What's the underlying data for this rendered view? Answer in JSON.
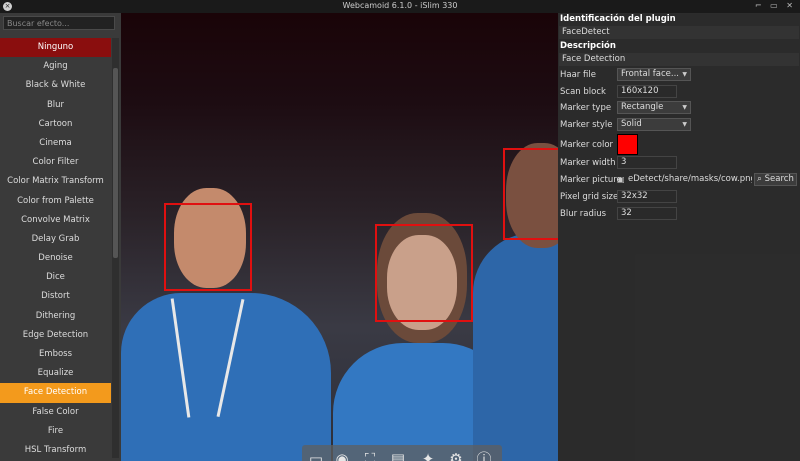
{
  "window": {
    "title": "Webcamoid 6.1.0 - iSlim 330"
  },
  "filters": {
    "search_placeholder": "Buscar efecto...",
    "items": [
      "Ninguno",
      "Aging",
      "Black & White",
      "Blur",
      "Cartoon",
      "Cinema",
      "Color Filter",
      "Color Matrix Transform",
      "Color from Palette",
      "Convolve Matrix",
      "Delay Grab",
      "Denoise",
      "Dice",
      "Distort",
      "Dithering",
      "Edge Detection",
      "Emboss",
      "Equalize",
      "Face Detection",
      "False Color",
      "Fire",
      "HSL Transform"
    ],
    "selected": "Face Detection"
  },
  "plugin": {
    "id_header": "Identificación del plugin",
    "id_value": "FaceDetect",
    "desc_header": "Descripción",
    "desc_value": "Face Detection"
  },
  "props": {
    "haar_file": {
      "label": "Haar file",
      "value": "Frontal face..."
    },
    "scan_block": {
      "label": "Scan block",
      "value": "160x120"
    },
    "marker_type": {
      "label": "Marker type",
      "value": "Rectangle"
    },
    "marker_style": {
      "label": "Marker style",
      "value": "Solid"
    },
    "marker_color": {
      "label": "Marker color",
      "value": "#ff0000"
    },
    "marker_width": {
      "label": "Marker width",
      "value": "3"
    },
    "marker_picture": {
      "label": "Marker picture",
      "value": "eDetect/share/masks/cow.png",
      "button": "Search"
    },
    "pixel_grid_size": {
      "label": "Pixel grid size",
      "value": "32x32"
    },
    "blur_radius": {
      "label": "Blur radius",
      "value": "32"
    }
  },
  "colors": {
    "selected_item": "#f39a1c",
    "first_item": "#8a0e0e",
    "face_box": "#e01010"
  }
}
